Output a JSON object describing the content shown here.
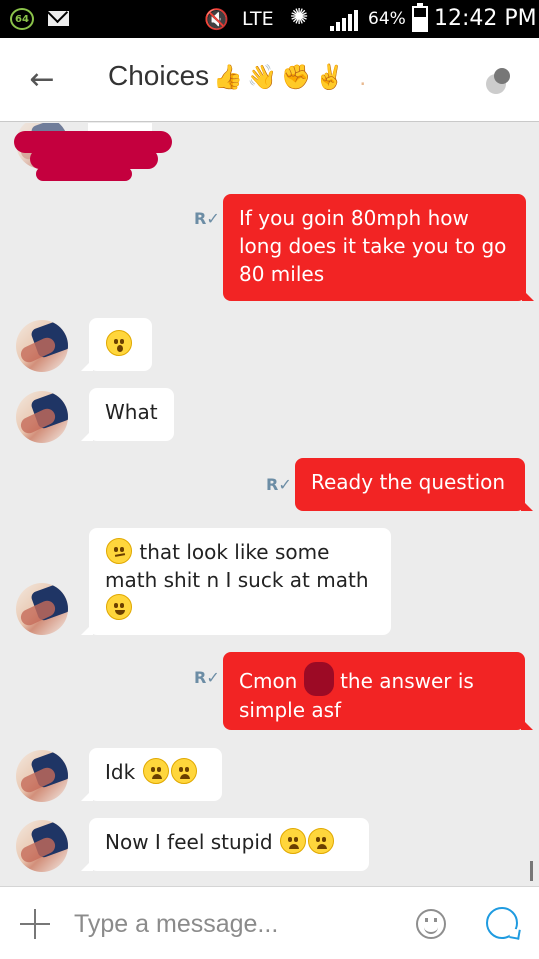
{
  "status_bar": {
    "badge": "64",
    "network": "LTE",
    "battery": "64%",
    "time": "12:42 PM",
    "icons": [
      "mail-icon",
      "mute-icon",
      "sync-icon",
      "signal-icon",
      "battery-icon"
    ]
  },
  "header": {
    "title": "Choices",
    "title_emojis": "👍👋✊✌ .",
    "back_icon": "back-arrow-icon",
    "menu_icon": "overflow-icon"
  },
  "messages": [
    {
      "from": "me",
      "text": "If you goin 80mph how long does it take you to go 80 miles",
      "read_mark": "R✓"
    },
    {
      "from": "them",
      "text": ""
    },
    {
      "from": "them",
      "text": "What"
    },
    {
      "from": "me",
      "text": "Ready the question",
      "read_mark": "R✓"
    },
    {
      "from": "them",
      "text_a": "that look like some math shit n I suck at",
      "text_b": "math"
    },
    {
      "from": "me",
      "text_a": "Cmon",
      "text_b": "the answer is simple asf",
      "read_mark": "R✓"
    },
    {
      "from": "them",
      "text": "Idk"
    },
    {
      "from": "them",
      "text": "Now I feel stupid"
    }
  ],
  "composer": {
    "placeholder": "Type a message..."
  },
  "colors": {
    "outgoing_bubble": "#f22424",
    "incoming_bubble": "#ffffff",
    "chat_bg": "#ececec",
    "accent": "#1f9be0"
  }
}
